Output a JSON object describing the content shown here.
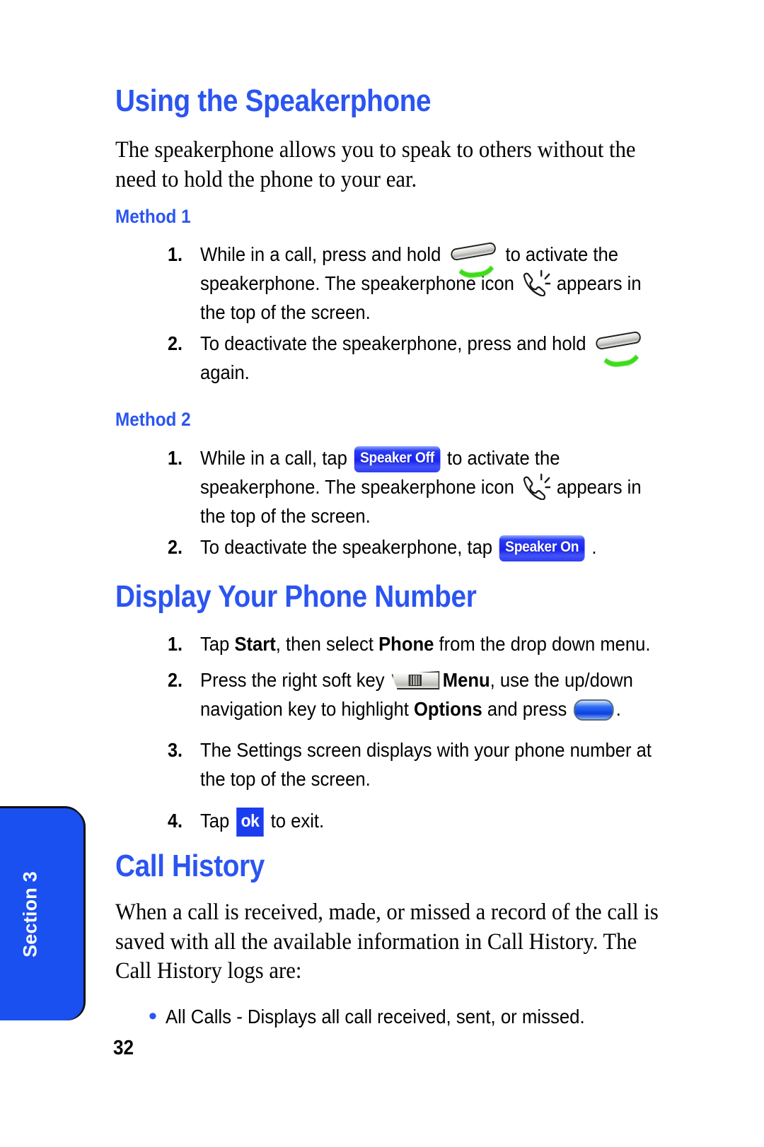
{
  "page": {
    "number": "32",
    "section_tab": "Section 3"
  },
  "sections": [
    {
      "heading": "Using the Speakerphone",
      "intro": "The speakerphone allows you to speak to others without the need to hold the phone to your ear.",
      "methods": [
        {
          "title": "Method 1",
          "steps": [
            {
              "number": "1.",
              "parts": [
                {
                  "t": "text",
                  "v": "While in a call, press and hold "
                },
                {
                  "t": "icon",
                  "v": "send-key-icon"
                },
                {
                  "t": "text",
                  "v": " to activate the speakerphone. The speakerphone icon "
                },
                {
                  "t": "icon",
                  "v": "speakerphone-icon"
                },
                {
                  "t": "text",
                  "v": " appears in the top of the screen."
                }
              ]
            },
            {
              "number": "2.",
              "parts": [
                {
                  "t": "text",
                  "v": "To deactivate the speakerphone, press and hold "
                },
                {
                  "t": "icon",
                  "v": "send-key-icon"
                },
                {
                  "t": "text",
                  "v": " again."
                }
              ]
            }
          ]
        },
        {
          "title": "Method 2",
          "steps": [
            {
              "number": "1.",
              "parts": [
                {
                  "t": "text",
                  "v": "While in a call, tap "
                },
                {
                  "t": "button",
                  "v": "Speaker Off"
                },
                {
                  "t": "text",
                  "v": " to activate the speakerphone. The speakerphone icon "
                },
                {
                  "t": "icon",
                  "v": "speakerphone-icon"
                },
                {
                  "t": "text",
                  "v": " appears in the top of the screen."
                }
              ]
            },
            {
              "number": "2.",
              "parts": [
                {
                  "t": "text",
                  "v": "To deactivate the speakerphone, tap "
                },
                {
                  "t": "button",
                  "v": "Speaker On"
                },
                {
                  "t": "text",
                  "v": " ."
                }
              ]
            }
          ]
        }
      ]
    },
    {
      "heading": "Display Your Phone Number",
      "steps": [
        {
          "number": "1.",
          "parts": [
            {
              "t": "text",
              "v": "Tap "
            },
            {
              "t": "strong",
              "v": "Start"
            },
            {
              "t": "text",
              "v": ", then select "
            },
            {
              "t": "strong",
              "v": "Phone"
            },
            {
              "t": "text",
              "v": " from the drop down menu."
            }
          ]
        },
        {
          "number": "2.",
          "parts": [
            {
              "t": "text",
              "v": "Press the right soft key "
            },
            {
              "t": "icon",
              "v": "soft-key-icon"
            },
            {
              "t": "strong",
              "v": "Menu"
            },
            {
              "t": "text",
              "v": ", use the up/down navigation key to highlight "
            },
            {
              "t": "strong",
              "v": "Options"
            },
            {
              "t": "text",
              "v": " and press "
            },
            {
              "t": "icon",
              "v": "action-key-icon"
            },
            {
              "t": "text",
              "v": "."
            }
          ]
        },
        {
          "number": "3.",
          "parts": [
            {
              "t": "text",
              "v": "The Settings screen displays with your phone number at the top of the screen."
            }
          ]
        },
        {
          "number": "4.",
          "parts": [
            {
              "t": "text",
              "v": "Tap "
            },
            {
              "t": "okbutton",
              "v": "ok"
            },
            {
              "t": "text",
              "v": " to exit."
            }
          ]
        }
      ]
    },
    {
      "heading": "Call History",
      "intro": "When a call is received, made, or missed a record of the call is saved with all the available information in Call History. The Call History logs are:",
      "bullets": [
        "All Calls - Displays all call received, sent, or missed."
      ]
    }
  ],
  "colors": {
    "accent_blue": "#2b55f0",
    "tab_blue": "#1a4ff0",
    "button_blue": "#1a22ee",
    "text_black": "#000000"
  }
}
